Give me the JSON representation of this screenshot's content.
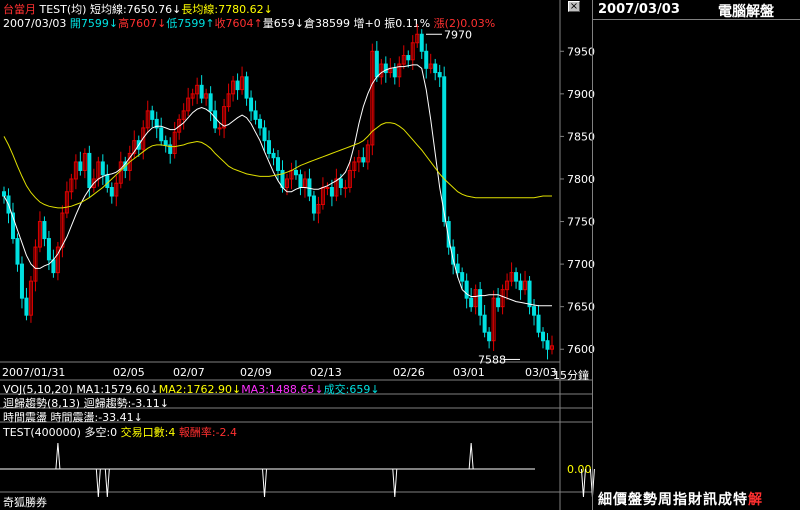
{
  "colors": {
    "up": "#e00000",
    "down": "#00e0e0",
    "line_short": "#ffffff",
    "line_long": "#e0e000",
    "label": "#ffff00",
    "red": "#ff3030",
    "grid": "#800000",
    "border": "#808080"
  },
  "header": {
    "row1": [
      {
        "t": "台當月",
        "c": "#ff3030"
      },
      {
        "t": " TEST(均) ",
        "c": "#ffffff"
      },
      {
        "t": "短均線:7650.76↓",
        "c": "#ffffff"
      },
      {
        "t": "長均線:7780.62↓",
        "c": "#ffff00"
      }
    ],
    "row2": [
      {
        "t": "2007/03/03 ",
        "c": "#ffffff"
      },
      {
        "t": "開7599↓",
        "c": "#00e0e0"
      },
      {
        "t": "高7607↓",
        "c": "#ff3030"
      },
      {
        "t": "低7599↑",
        "c": "#00e0e0"
      },
      {
        "t": "收7604↑",
        "c": "#ff3030"
      },
      {
        "t": "量659↓",
        "c": "#ffffff"
      },
      {
        "t": "倉38599 ",
        "c": "#ffffff"
      },
      {
        "t": "增+0 ",
        "c": "#ffffff"
      },
      {
        "t": "振0.11% ",
        "c": "#ffffff"
      },
      {
        "t": "漲(2)0.03%",
        "c": "#ff3030"
      }
    ]
  },
  "chart_data": [
    {
      "type": "candlestick",
      "yticks": [
        "7950",
        "7900",
        "7850",
        "7800",
        "7750",
        "7700",
        "7650",
        "7600"
      ],
      "ylim": [
        7585,
        7975
      ],
      "xticks": [
        "2007/01/31",
        "02/05",
        "02/07",
        "02/09",
        "02/13",
        "02/26",
        "03/01",
        "03/03"
      ],
      "annotations": [
        {
          "text": "7970",
          "value": 7970
        },
        {
          "text": "7588",
          "value": 7588
        }
      ],
      "close": [
        7780,
        7760,
        7730,
        7700,
        7660,
        7640,
        7680,
        7720,
        7750,
        7730,
        7705,
        7690,
        7720,
        7760,
        7785,
        7800,
        7820,
        7810,
        7830,
        7790,
        7800,
        7820,
        7805,
        7790,
        7780,
        7795,
        7820,
        7810,
        7830,
        7845,
        7835,
        7860,
        7880,
        7870,
        7860,
        7845,
        7840,
        7830,
        7855,
        7870,
        7880,
        7895,
        7900,
        7910,
        7895,
        7900,
        7880,
        7860,
        7860,
        7885,
        7900,
        7915,
        7905,
        7920,
        7895,
        7880,
        7870,
        7860,
        7845,
        7830,
        7825,
        7810,
        7790,
        7800,
        7810,
        7805,
        7790,
        7800,
        7780,
        7760,
        7770,
        7790,
        7790,
        7780,
        7800,
        7790,
        7790,
        7810,
        7820,
        7825,
        7820,
        7840,
        7950,
        7920,
        7935,
        7925,
        7930,
        7920,
        7935,
        7945,
        7940,
        7960,
        7970,
        7950,
        7930,
        7935,
        7925,
        7920,
        7750,
        7720,
        7700,
        7690,
        7680,
        7660,
        7650,
        7670,
        7640,
        7620,
        7610,
        7660,
        7650,
        7670,
        7680,
        7690,
        7680,
        7670,
        7680,
        7650,
        7640,
        7620,
        7610,
        7600,
        7604
      ],
      "series": [
        {
          "name": "短均線",
          "values": [
            7780,
            7770,
            7755,
            7740,
            7725,
            7710,
            7700,
            7695,
            7695,
            7698,
            7700,
            7705,
            7712,
            7722,
            7732,
            7745,
            7758,
            7770,
            7780,
            7788,
            7795,
            7800,
            7803,
            7805,
            7806,
            7808,
            7812,
            7818,
            7825,
            7832,
            7840,
            7848,
            7855,
            7860,
            7862,
            7862,
            7860,
            7858,
            7858,
            7862,
            7866,
            7872,
            7878,
            7882,
            7884,
            7882,
            7878,
            7872,
            7866,
            7862,
            7864,
            7868,
            7872,
            7875,
            7872,
            7865,
            7855,
            7845,
            7832,
            7820,
            7808,
            7798,
            7790,
            7785,
            7785,
            7788,
            7790,
            7790,
            7789,
            7788,
            7788,
            7790,
            7792,
            7795,
            7798,
            7802,
            7808,
            7820,
            7840,
            7865,
            7885,
            7900,
            7912,
            7920,
            7925,
            7928,
            7930,
            7931,
            7932,
            7932,
            7933,
            7934,
            7934,
            7930,
            7905,
            7870,
            7830,
            7790,
            7760,
            7730,
            7705,
            7685,
            7670,
            7665,
            7662,
            7662,
            7663,
            7663,
            7664,
            7664,
            7664,
            7662,
            7660,
            7658,
            7656,
            7655,
            7654,
            7653,
            7652,
            7651,
            7651,
            7651,
            7651
          ]
        },
        {
          "name": "長均線",
          "values": [
            7850,
            7840,
            7828,
            7815,
            7803,
            7792,
            7784,
            7778,
            7773,
            7770,
            7768,
            7767,
            7766,
            7766,
            7767,
            7768,
            7770,
            7772,
            7775,
            7778,
            7782,
            7786,
            7790,
            7795,
            7800,
            7805,
            7810,
            7815,
            7820,
            7824,
            7828,
            7832,
            7836,
            7839,
            7840,
            7840,
            7839,
            7838,
            7838,
            7839,
            7840,
            7842,
            7843,
            7844,
            7843,
            7840,
            7836,
            7830,
            7825,
            7820,
            7815,
            7812,
            7810,
            7808,
            7806,
            7805,
            7804,
            7803,
            7803,
            7803,
            7804,
            7805,
            7806,
            7808,
            7810,
            7813,
            7816,
            7818,
            7820,
            7822,
            7824,
            7826,
            7828,
            7830,
            7832,
            7834,
            7836,
            7838,
            7840,
            7842,
            7845,
            7850,
            7856,
            7860,
            7864,
            7866,
            7866,
            7865,
            7862,
            7858,
            7852,
            7846,
            7840,
            7834,
            7827,
            7820,
            7813,
            7806,
            7800,
            7795,
            7790,
            7785,
            7782,
            7780,
            7779,
            7778,
            7778,
            7778,
            7778,
            7778,
            7778,
            7778,
            7778,
            7778,
            7778,
            7778,
            7778,
            7778,
            7778,
            7779,
            7780,
            7780,
            7780
          ]
        }
      ]
    },
    {
      "type": "indicator",
      "yticks": [
        "0.00"
      ],
      "markers": [
        {
          "index": 12,
          "dir": "up"
        },
        {
          "index": 21,
          "dir": "down"
        },
        {
          "index": 23,
          "dir": "down"
        },
        {
          "index": 58,
          "dir": "down"
        },
        {
          "index": 87,
          "dir": "down"
        },
        {
          "index": 104,
          "dir": "up"
        },
        {
          "index": 129,
          "dir": "down"
        },
        {
          "index": 131,
          "dir": "down"
        }
      ]
    }
  ],
  "x_end_label": "15分鐘",
  "indicators": {
    "voj": [
      {
        "t": "VOJ(5,10,20) ",
        "c": "#ffffff"
      },
      {
        "t": "MA1:1579.60↓",
        "c": "#ffffff"
      },
      {
        "t": "MA2:1762.90↓",
        "c": "#ffff00"
      },
      {
        "t": "MA3:1488.65↓",
        "c": "#ff30ff"
      },
      {
        "t": "成交:659↓",
        "c": "#00e0e0"
      }
    ],
    "regress": "迴歸趨勢(8,13) 迴歸趨勢:-3.11↓",
    "time": "時間震盪 時間震盪:-33.41↓",
    "test": [
      {
        "t": "TEST(400000) 多空:0 ",
        "c": "#ffffff"
      },
      {
        "t": "交易口數:4 ",
        "c": "#ffff00"
      },
      {
        "t": "報酬率:-2.4",
        "c": "#ff3030"
      }
    ]
  },
  "footer": {
    "brand": "奇狐勝券"
  },
  "right_panel": {
    "date": "2007/03/03",
    "title": "電腦解盤",
    "tabs": [
      "細",
      "價",
      "盤",
      "勢",
      "周",
      "指",
      "財",
      "訊",
      "成",
      "特"
    ],
    "tab_last": "解"
  }
}
